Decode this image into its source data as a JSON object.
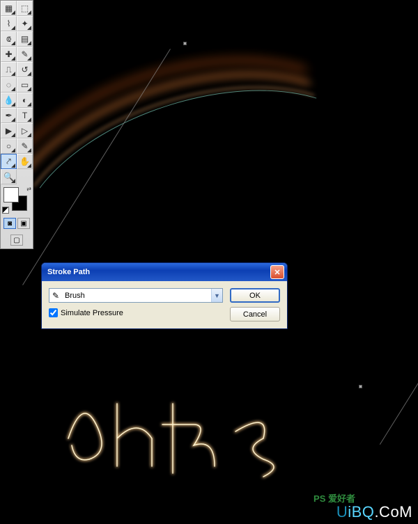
{
  "toolbox": {
    "tools": [
      [
        "move",
        "▦",
        "marquee",
        "⬚"
      ],
      [
        "lasso",
        "⌇",
        "wand",
        "✦"
      ],
      [
        "crop",
        "⟃",
        "slice",
        "▤"
      ],
      [
        "heal",
        "✚",
        "brush",
        "✎"
      ],
      [
        "stamp",
        "⎍",
        "history-brush",
        "↺"
      ],
      [
        "eraser",
        "◌",
        "gradient",
        "▭"
      ],
      [
        "blur",
        "💧",
        "dodge",
        "◐"
      ],
      [
        "pen",
        "✒",
        "type",
        "T"
      ],
      [
        "path-select",
        "▶",
        "direct-select",
        "▷"
      ],
      [
        "shape",
        "○",
        "notes",
        "✎"
      ],
      [
        "eyedropper",
        "⤤",
        "hand",
        "✋"
      ],
      [
        "zoom",
        "🔍",
        "",
        ""
      ]
    ],
    "active": "eyedropper",
    "modes": {
      "quickmask": "◙",
      "screenmode": "▣"
    }
  },
  "dialog": {
    "title": "Stroke Path",
    "tool_icon": "✎",
    "tool_label": "Brush",
    "simulate_label": "Simulate Pressure",
    "simulate_checked": true,
    "ok": "OK",
    "cancel": "Cancel"
  },
  "watermark": {
    "ps": "PS 爱好者",
    "u": "U",
    "ibq": "iBQ",
    "com": ".CoM"
  }
}
